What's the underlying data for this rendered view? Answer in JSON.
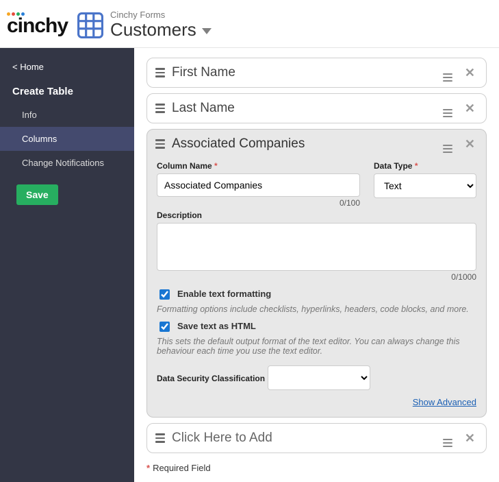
{
  "header": {
    "logo": "cinchy",
    "context": "Cinchy Forms",
    "title": "Customers"
  },
  "sidebar": {
    "home_label": "< Home",
    "heading": "Create Table",
    "items": [
      {
        "label": "Info"
      },
      {
        "label": "Columns"
      },
      {
        "label": "Change Notifications"
      }
    ],
    "save_label": "Save"
  },
  "columns": {
    "collapsed": [
      {
        "title": "First Name"
      },
      {
        "title": "Last Name"
      }
    ],
    "expanded": {
      "title": "Associated Companies",
      "column_name_label": "Column Name",
      "column_name_value": "Associated Companies",
      "column_name_counter": "0/100",
      "data_type_label": "Data Type",
      "data_type_value": "Text",
      "description_label": "Description",
      "description_value": "",
      "description_counter": "0/1000",
      "enable_formatting_label": "Enable text formatting",
      "enable_formatting_hint": "Formatting options include checklists, hyperlinks, headers, code blocks, and more.",
      "save_html_label": "Save text as HTML",
      "save_html_hint": "This sets the default output format of the text editor. You can always change this behaviour each time you use the text editor.",
      "dsc_label": "Data Security Classification",
      "show_advanced_label": "Show Advanced"
    },
    "add_row": "Click Here to Add"
  },
  "footnote": "Required Field"
}
